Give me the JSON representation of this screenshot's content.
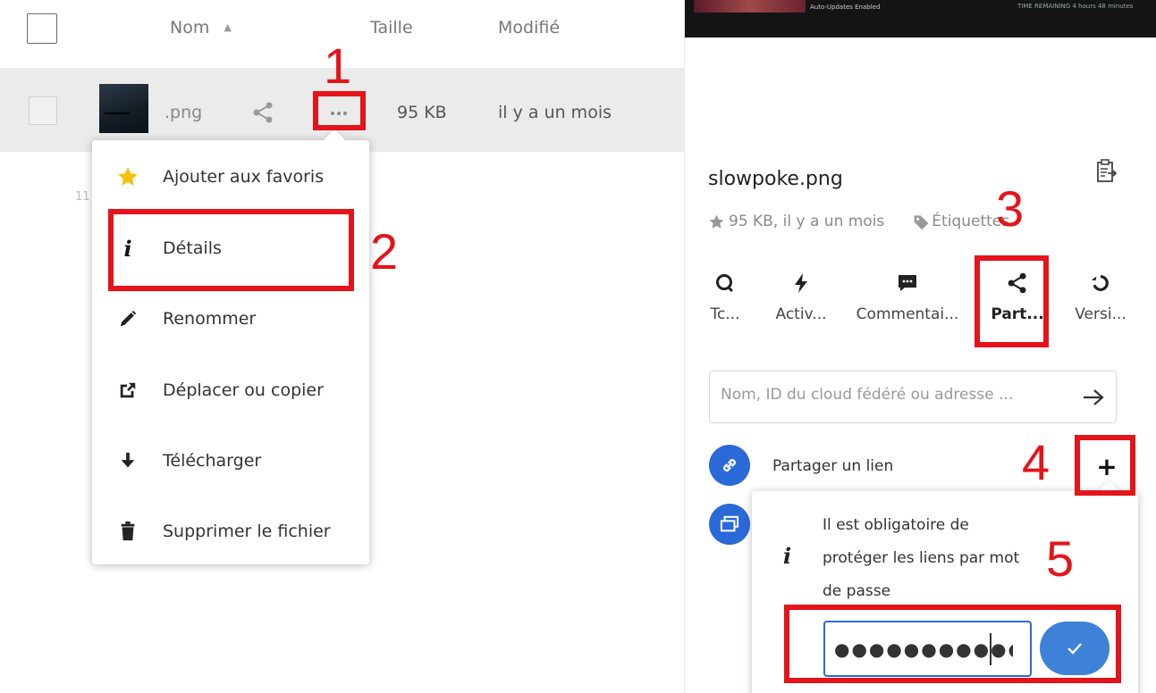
{
  "list_header": {
    "name_label": "Nom",
    "size_label": "Taille",
    "modified_label": "Modifié",
    "sort_indicator": "▲"
  },
  "file_row": {
    "name": ".png",
    "size": "95 KB",
    "modified": "il y a un mois"
  },
  "stray_text": "11",
  "context_menu": {
    "items": [
      {
        "label": "Ajouter aux favoris",
        "icon": "star-icon"
      },
      {
        "label": "Détails",
        "icon": "info-icon"
      },
      {
        "label": "Renommer",
        "icon": "pencil-icon"
      },
      {
        "label": "Déplacer ou copier",
        "icon": "external-link-icon"
      },
      {
        "label": "Télécharger",
        "icon": "download-icon"
      },
      {
        "label": "Supprimer le fichier",
        "icon": "trash-icon"
      }
    ]
  },
  "banner": {
    "left_text": "Auto-Updates Enabled",
    "right_text": "TIME REMAINING  4 hours 48 minutes"
  },
  "sidebar": {
    "filename": "slowpoke.png",
    "meta": "95 KB, il y a un mois",
    "tags_label": "Étiquettes",
    "tabs": [
      {
        "label": "Tc...",
        "icon": "search-icon"
      },
      {
        "label": "Activ...",
        "icon": "activity-icon"
      },
      {
        "label": "Commentai...",
        "icon": "comment-icon"
      },
      {
        "label": "Part...",
        "icon": "share-icon",
        "active": true
      },
      {
        "label": "Versi...",
        "icon": "history-icon"
      }
    ],
    "share_placeholder": "Nom, ID du cloud fédéré ou adresse ...",
    "share_link_label": "Partager un lien",
    "plus_label": "+",
    "popover_text": "Il est obligatoire de protéger les liens par mot de passe",
    "password_value": "●●●●●●●●●●●●"
  },
  "annotations": [
    "1",
    "2",
    "3",
    "4",
    "5"
  ],
  "colors": {
    "annotation_red": "#e5131a",
    "primary_blue": "#2a6ad8",
    "row_highlight": "#ebebeb",
    "star_yellow": "#f4c20d"
  }
}
